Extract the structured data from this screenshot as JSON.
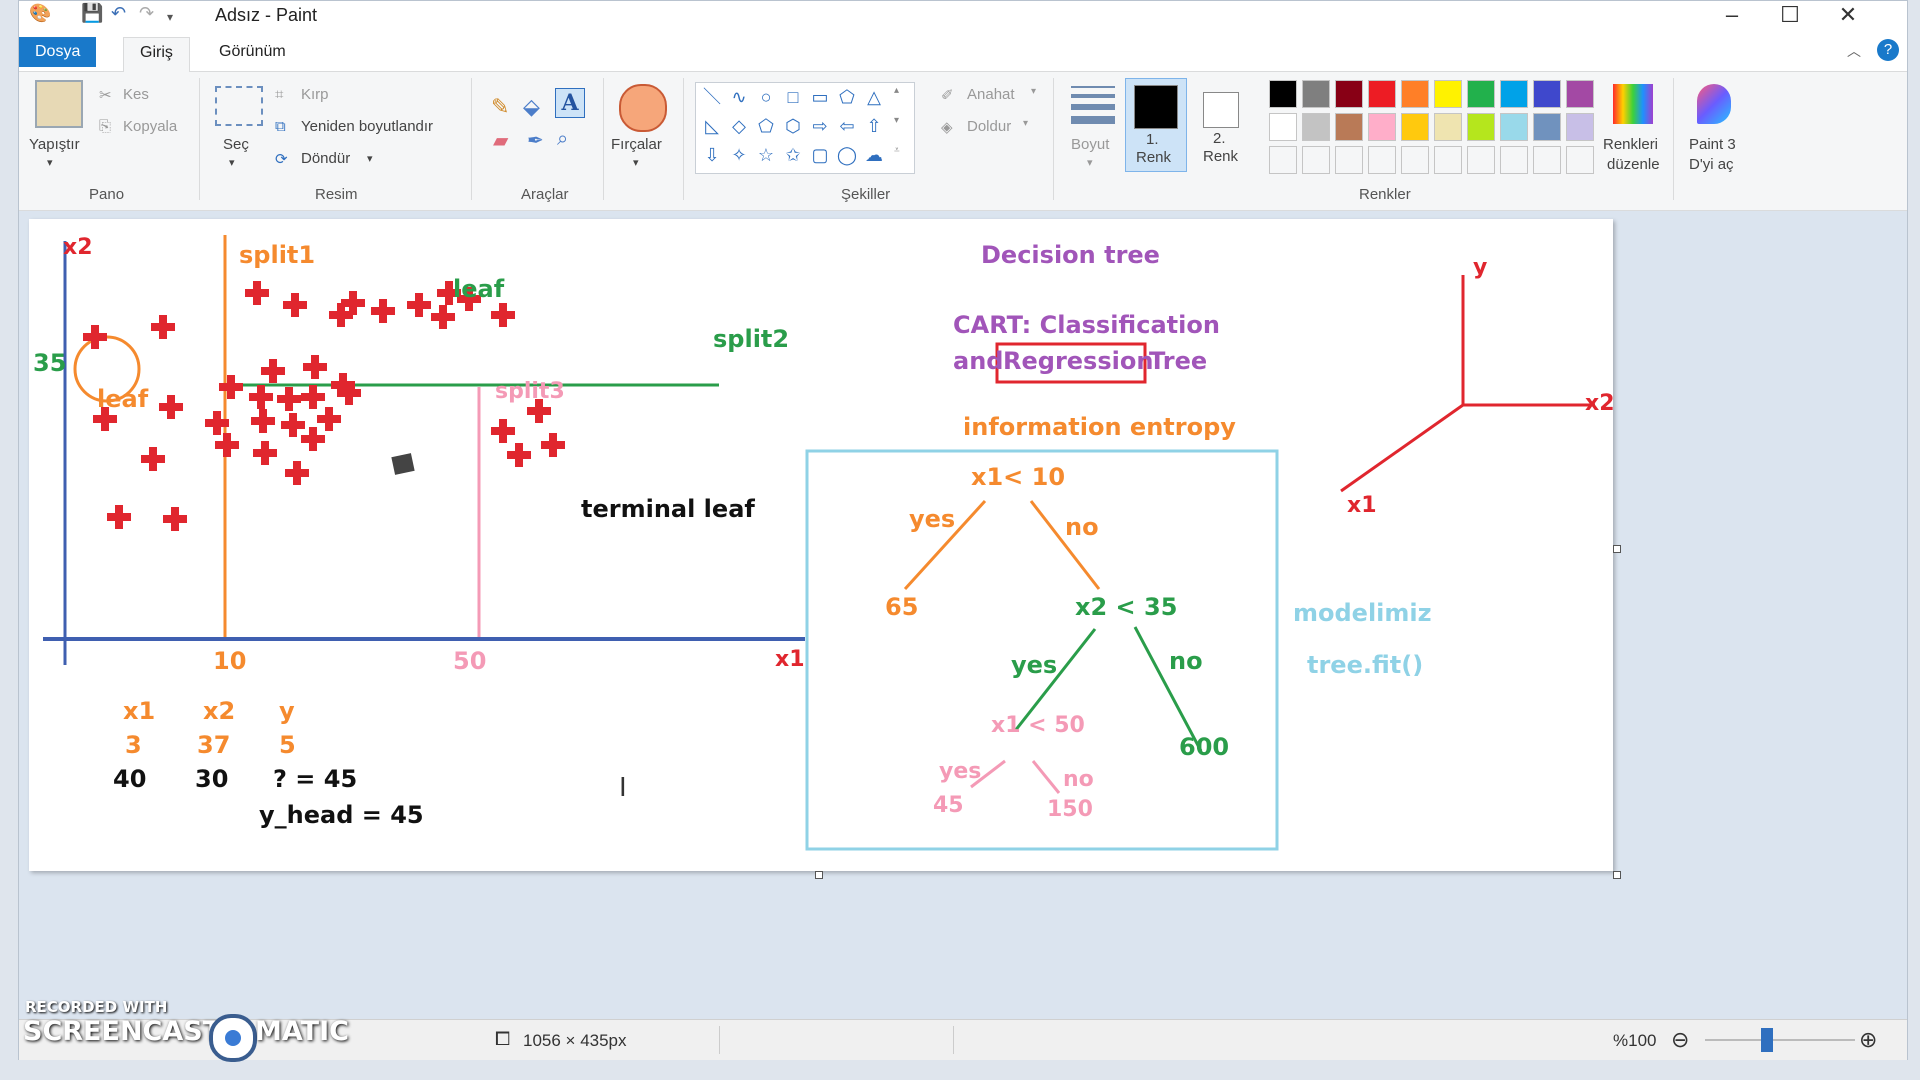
{
  "window": {
    "title": "Adsız - Paint"
  },
  "tabs": [
    "Dosya",
    "Giriş",
    "Görünüm"
  ],
  "ribbon": {
    "clipboard": {
      "paste": "Yapıştır",
      "cut": "Kes",
      "copy": "Kopyala",
      "group": "Pano"
    },
    "image": {
      "select": "Seç",
      "crop": "Kırp",
      "resize": "Yeniden boyutlandır",
      "rotate": "Döndür",
      "group": "Resim"
    },
    "tools": {
      "group": "Araçlar"
    },
    "brushes": {
      "label": "Fırçalar"
    },
    "shapes": {
      "outline": "Anahat",
      "fill": "Doldur",
      "group": "Şekiller"
    },
    "size": {
      "label": "Boyut"
    },
    "color1": {
      "num": "1.",
      "label": "Renk"
    },
    "color2": {
      "num": "2.",
      "label": "Renk"
    },
    "colors": {
      "edit_line1": "Renkleri",
      "edit_line2": "düzenle",
      "group": "Renkler",
      "row1": [
        "#000000",
        "#7f7f7f",
        "#880015",
        "#ed1c24",
        "#ff7f27",
        "#fff200",
        "#22b14c",
        "#00a2e8",
        "#3f48cc",
        "#a349a4"
      ],
      "row2": [
        "#ffffff",
        "#c3c3c3",
        "#b97a57",
        "#ffaec9",
        "#ffc90e",
        "#efe4b0",
        "#b5e61d",
        "#99d9ea",
        "#7092be",
        "#c8bfe7"
      ]
    },
    "paint3d": {
      "line1": "Paint 3",
      "line2": "D'yi aç"
    }
  },
  "canvas": {
    "plot": {
      "x_axis": "x1",
      "y_axis": "x2",
      "tick_10": "10",
      "tick_50": "50",
      "tick_35": "35",
      "split1": "split1",
      "split2": "split2",
      "split3": "split3",
      "leaf_top": "leaf",
      "leaf_left": "leaf",
      "terminal": "terminal leaf"
    },
    "table": {
      "headers": [
        "x1",
        "x2",
        "y"
      ],
      "row1": [
        "3",
        "37",
        "5"
      ],
      "row2": [
        "40",
        "30",
        "? = 45"
      ],
      "y_head": "y_head = 45"
    },
    "title": "Decision tree",
    "cart_line1": "CART: Classification",
    "cart_and": "and",
    "cart_regression": "Regression",
    "cart_tree": "Tree",
    "entropy": "information entropy",
    "tree": {
      "root": "x1< 10",
      "yes1": "yes",
      "no1": "no",
      "leaf65": "65",
      "node2": "x2 < 35",
      "yes2": "yes",
      "no2": "no",
      "leaf600": "600",
      "node3": "x1 < 50",
      "yes3": "yes",
      "no3": "no",
      "leaf45": "45",
      "leaf150": "150"
    },
    "model": "modelimiz",
    "fit": "tree.fit()",
    "axes3d": {
      "y": "y",
      "x2": "x2",
      "x1": "x1"
    }
  },
  "status": {
    "size": "1056 × 435px",
    "zoom": "%100",
    "recorded": "RECORDED WITH",
    "brand": "SCREENCAST",
    "brand2": "MATIC"
  }
}
